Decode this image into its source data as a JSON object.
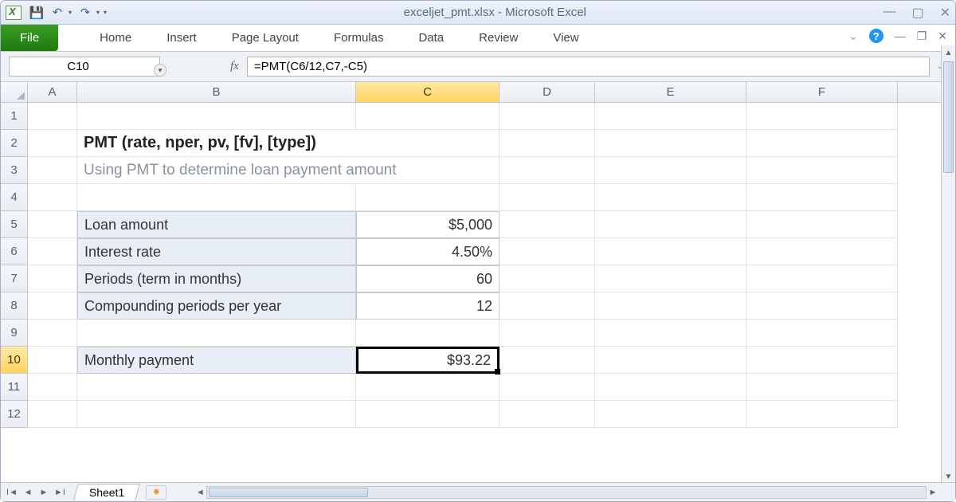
{
  "window": {
    "title": "exceljet_pmt.xlsx - Microsoft Excel"
  },
  "qat": {
    "save": "💾",
    "undo": "↶",
    "redo": "↷"
  },
  "ribbon": {
    "file": "File",
    "tabs": [
      "Home",
      "Insert",
      "Page Layout",
      "Formulas",
      "Data",
      "Review",
      "View"
    ]
  },
  "namebox": "C10",
  "fx_label": "fx",
  "formula": "=PMT(C6/12,C7,-C5)",
  "columns": [
    "A",
    "B",
    "C",
    "D",
    "E",
    "F"
  ],
  "rows_shown": 12,
  "active_cell": {
    "row": 10,
    "col": "C"
  },
  "content": {
    "r2": {
      "B": "PMT (rate, nper, pv, [fv], [type])"
    },
    "r3": {
      "B": "Using PMT to determine loan payment amount"
    },
    "r5": {
      "B": "Loan amount",
      "C": "$5,000"
    },
    "r6": {
      "B": "Interest rate",
      "C": "4.50%"
    },
    "r7": {
      "B": "Periods (term in months)",
      "C": "60"
    },
    "r8": {
      "B": "Compounding periods per year",
      "C": "12"
    },
    "r10": {
      "B": "Monthly payment",
      "C": "$93.22"
    }
  },
  "sheet_tabs": [
    "Sheet1"
  ]
}
